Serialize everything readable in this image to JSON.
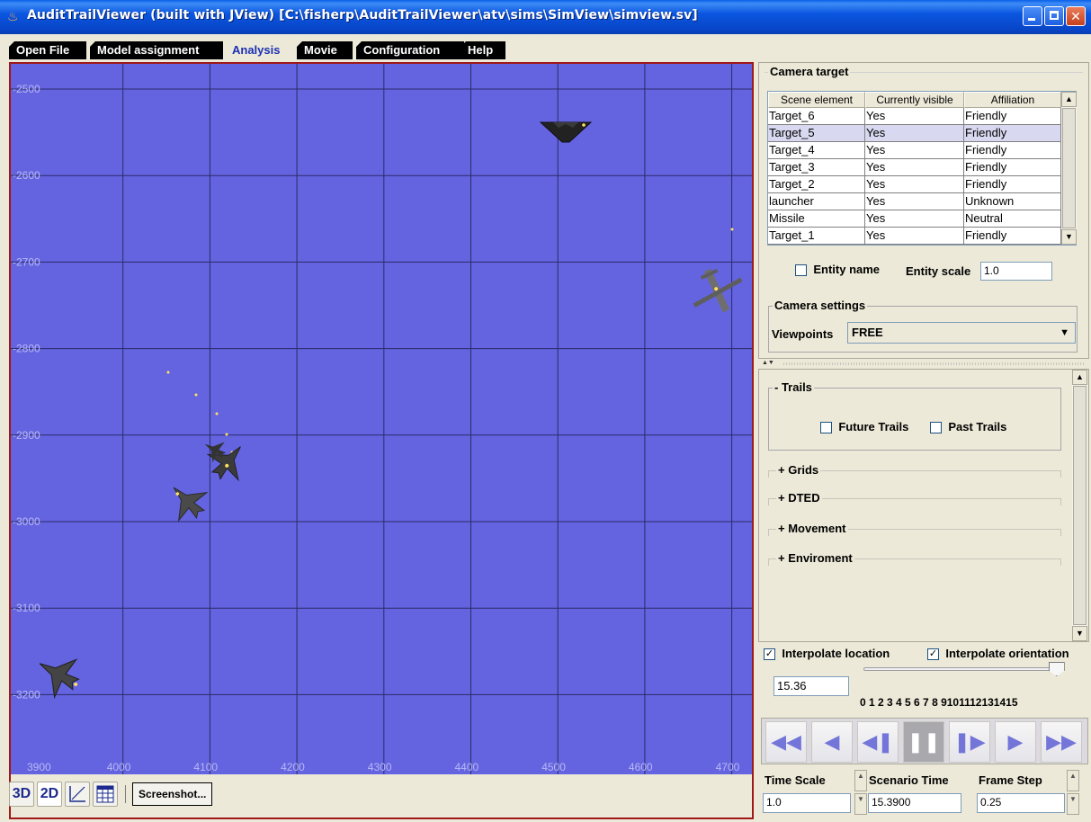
{
  "window": {
    "title": "AuditTrailViewer (built with JView)  [C:\\fisherp\\AuditTrailViewer\\atv\\sims\\SimView\\simview.sv]"
  },
  "tabs": [
    {
      "label": "Open File"
    },
    {
      "label": "Model assignment"
    },
    {
      "label": "Analysis"
    },
    {
      "label": "Movie"
    },
    {
      "label": "Configuration"
    },
    {
      "label": "Help"
    }
  ],
  "map": {
    "background": "#6464e0",
    "grid_color": "#2a2a68",
    "x_ticks": [
      "3900",
      "4000",
      "4100",
      "4200",
      "4300",
      "4400",
      "4500",
      "4600",
      "4700"
    ],
    "y_ticks": [
      "-2500",
      "-2600",
      "-2700",
      "-2800",
      "-2900",
      "-3000",
      "-3100",
      "-3200"
    ]
  },
  "toolbar": {
    "btn_3d": "3D",
    "btn_2d": "2D",
    "screenshot": "Screenshot..."
  },
  "camera_target": {
    "title": "Camera target",
    "columns": [
      "Scene element",
      "Currently visible",
      "Affiliation"
    ],
    "rows": [
      {
        "name": "Target_6",
        "visible": "Yes",
        "affiliation": "Friendly"
      },
      {
        "name": "Target_5",
        "visible": "Yes",
        "affiliation": "Friendly"
      },
      {
        "name": "Target_4",
        "visible": "Yes",
        "affiliation": "Friendly"
      },
      {
        "name": "Target_3",
        "visible": "Yes",
        "affiliation": "Friendly"
      },
      {
        "name": "Target_2",
        "visible": "Yes",
        "affiliation": "Friendly"
      },
      {
        "name": "launcher",
        "visible": "Yes",
        "affiliation": "Unknown"
      },
      {
        "name": "Missile",
        "visible": "Yes",
        "affiliation": "Neutral"
      },
      {
        "name": "Target_1",
        "visible": "Yes",
        "affiliation": "Friendly"
      }
    ],
    "entity_name_label": "Entity name",
    "entity_scale_label": "Entity scale",
    "entity_scale_value": "1.0",
    "camera_settings_title": "Camera settings",
    "viewpoints_label": "Viewpoints",
    "viewpoints_value": "FREE"
  },
  "options": {
    "trails_title": "- Trails",
    "future_trails": "Future Trails",
    "past_trails": "Past Trails",
    "sections": [
      "+ Grids",
      "+ DTED",
      "+ Movement",
      "+ Enviroment"
    ]
  },
  "playback": {
    "interpolate_location": "Interpolate location",
    "interpolate_orientation": "Interpolate orientation",
    "time_value": "15.36",
    "slider_ticks": "0 1 2 3 4 5 6 7 8 9101112131415",
    "slider_fraction": 0.99,
    "time_scale_label": "Time Scale",
    "time_scale_value": "1.0",
    "scenario_time_label": "Scenario Time",
    "scenario_time_value": "15.3900",
    "frame_step_label": "Frame Step",
    "frame_step_value": "0.25"
  }
}
